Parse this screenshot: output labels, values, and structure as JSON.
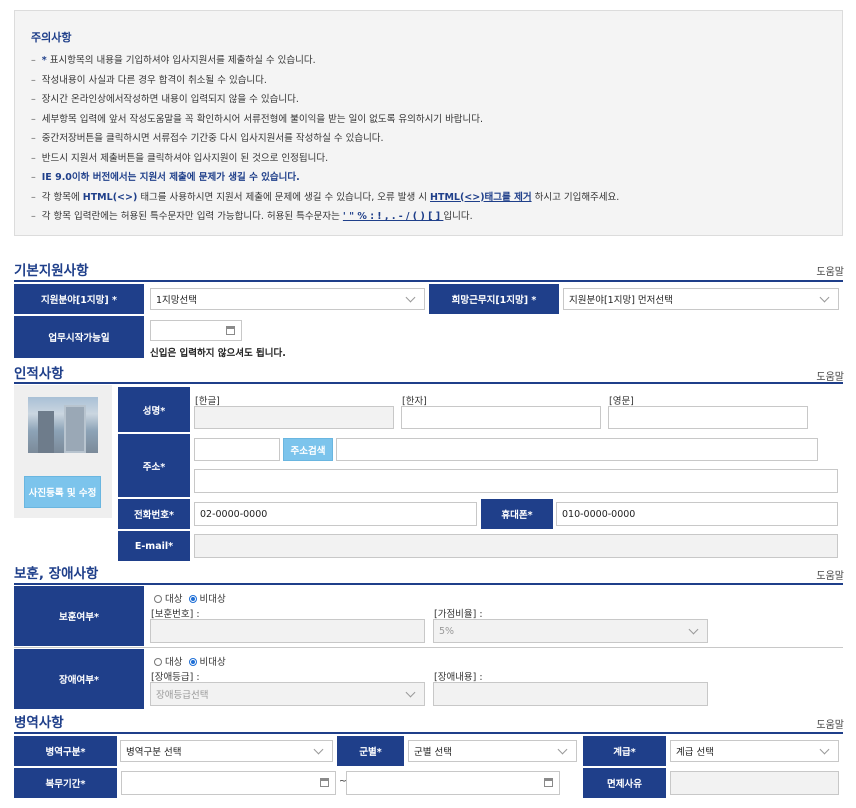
{
  "notice": {
    "title": "주의사항",
    "items": [
      {
        "star": "*",
        "text": " 표시항목의 내용을 기입하셔야 입사지원서를 제출하실 수 있습니다."
      },
      {
        "text": "작성내용이 사실과 다른 경우 합격이 취소될 수 있습니다."
      },
      {
        "text": "장시간 온라인상에서작성하면 내용이 입력되지 않을 수 있습니다."
      },
      {
        "text": "세부항목 입력에 앞서 작성도움말을 꼭 확인하시어 서류전형에 불이익을 받는 일이 없도록 유의하시기 바랍니다."
      },
      {
        "text": "중간저장버튼을 클릭하시면 서류접수 기간중 다시 입사지원서를 작성하실 수 있습니다."
      },
      {
        "text": "반드시 지원서 제출버튼을 클릭하셔야 입사지원이 된 것으로 인정됩니다."
      },
      {
        "highlight": "IE 9.0이하 버전에서는 지원서 제출에 문제가 생길 수 있습니다."
      },
      {
        "pre": "각 항목에 ",
        "b1": "HTML(<>)",
        "mid": " 태그를 사용하시면 지원서 제출에 문제에 생길 수 있습니다, 오류 발생 시 ",
        "u1": "HTML(<>)태그를 제거",
        "post": " 하시고 기입해주세요."
      },
      {
        "pre": "각 항목 입력란에는 허용된 특수문자만 입력 가능합니다. 허용된 특수문자는 ",
        "u1": " '  \"  %  :  !  ,  .  -  /  (  )  [  ] ",
        "post": "입니다."
      }
    ]
  },
  "help_label": "도움말",
  "basic": {
    "title": "기본지원사항",
    "field1_label": "지원분야[1지망] *",
    "field1_value": "1지망선택",
    "field2_label": "희망근무지[1지망] *",
    "field2_value": "지원분야[1지망] 먼저선택",
    "start_label": "업무시작가능일",
    "start_note": "신입은 입력하지 않으셔도 됩니다."
  },
  "personal": {
    "title": "인적사항",
    "photo_button": "사진등록 및 수정",
    "name_label": "성명*",
    "name_korean": "[한글]",
    "name_hanja": "[한자]",
    "name_english": "[영문]",
    "address_label": "주소*",
    "address_search": "주소검색",
    "phone_label": "전화번호*",
    "phone_placeholder": "02-0000-0000",
    "mobile_label": "휴대폰*",
    "mobile_placeholder": "010-0000-0000",
    "email_label": "E-mail*"
  },
  "veteran": {
    "title": "보훈, 장애사항",
    "veteran_label": "보훈여부*",
    "opt_target": "대상",
    "opt_nontarget": "비대상",
    "veteran_no": "[보훈번호] :",
    "bonus_rate": "[가점비율] :",
    "bonus_value": "5%",
    "disability_label": "장애여부*",
    "disability_grade": "[장애등급] :",
    "disability_content": "[장애내용] :",
    "grade_select": "장애등급선택"
  },
  "military": {
    "title": "병역사항",
    "type_label": "병역구분*",
    "type_value": "병역구분 선택",
    "branch_label": "군별*",
    "branch_value": "군별 선택",
    "rank_label": "계급*",
    "rank_value": "계급 선택",
    "period_label": "복무기간*",
    "tilde": "~",
    "exempt_label": "면제사유"
  }
}
